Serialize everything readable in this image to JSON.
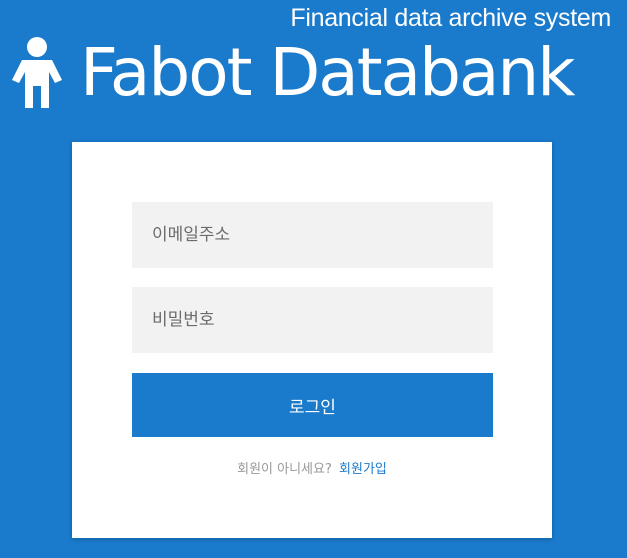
{
  "header": {
    "tagline": "Financial data archive system",
    "brand_name": "Fabot Databank",
    "brand_icon": "person-icon"
  },
  "login_form": {
    "email_placeholder": "이메일주소",
    "password_placeholder": "비밀번호",
    "login_label": "로그인",
    "signup_prompt": "회원이 아니세요?",
    "signup_link": "회원가입"
  },
  "colors": {
    "background": "#1a7acc",
    "button": "#1a7acc",
    "input_background": "#f2f2f2",
    "link": "#1a7acc"
  }
}
